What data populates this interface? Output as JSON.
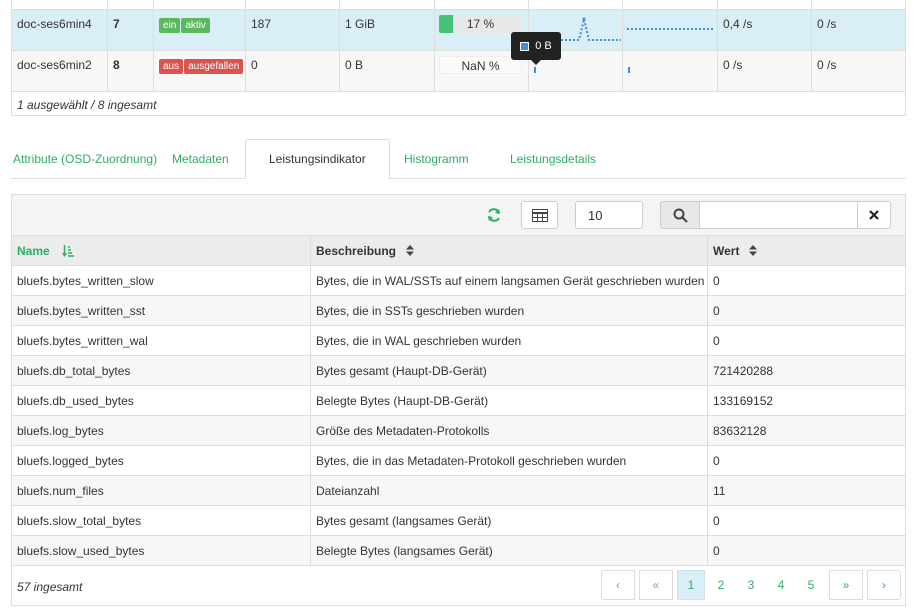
{
  "osd_rows": [
    {
      "host": "doc-ses6min4",
      "id": "7",
      "status": [
        "ein",
        "aktiv"
      ],
      "pgs": "187",
      "size": "1 GiB",
      "usage": "17 %",
      "usage_fraction": 0.17,
      "read_rate": "0,4 /s",
      "write_rate": "0 /s"
    },
    {
      "host": "doc-ses6min2",
      "id": "8",
      "status": [
        "aus",
        "ausgefallen"
      ],
      "pgs": "0",
      "size": "0 B",
      "usage": "NaN %",
      "usage_fraction": 0,
      "read_rate": "0 /s",
      "write_rate": "0 /s"
    }
  ],
  "selection_summary": "1 ausgewählt / 8 ingesamt",
  "tooltip": "0 B",
  "tabs": [
    {
      "label": "Attribute (OSD-Zuordnung)",
      "active": false
    },
    {
      "label": "Metadaten",
      "active": false
    },
    {
      "label": "Leistungsindikator",
      "active": true
    },
    {
      "label": "Histogramm",
      "active": false
    },
    {
      "label": "Leistungsdetails",
      "active": false
    }
  ],
  "toolbar": {
    "page_size": "10",
    "search_placeholder": ""
  },
  "columns": {
    "name": "Name",
    "description": "Beschreibung",
    "value": "Wert"
  },
  "rows": [
    {
      "name": "bluefs.bytes_written_slow",
      "description": "Bytes, die in WAL/SSTs auf einem langsamen Gerät geschrieben wurden",
      "value": "0"
    },
    {
      "name": "bluefs.bytes_written_sst",
      "description": "Bytes, die in SSTs geschrieben wurden",
      "value": "0"
    },
    {
      "name": "bluefs.bytes_written_wal",
      "description": "Bytes, die in WAL geschrieben wurden",
      "value": "0"
    },
    {
      "name": "bluefs.db_total_bytes",
      "description": "Bytes gesamt (Haupt-DB-Gerät)",
      "value": "721420288"
    },
    {
      "name": "bluefs.db_used_bytes",
      "description": "Belegte Bytes (Haupt-DB-Gerät)",
      "value": "133169152"
    },
    {
      "name": "bluefs.log_bytes",
      "description": "Größe des Metadaten-Protokolls",
      "value": "83632128"
    },
    {
      "name": "bluefs.logged_bytes",
      "description": "Bytes, die in das Metadaten-Protokoll geschrieben wurden",
      "value": "0"
    },
    {
      "name": "bluefs.num_files",
      "description": "Dateianzahl",
      "value": "11"
    },
    {
      "name": "bluefs.slow_total_bytes",
      "description": "Bytes gesamt (langsames Gerät)",
      "value": "0"
    },
    {
      "name": "bluefs.slow_used_bytes",
      "description": "Belegte Bytes (langsames Gerät)",
      "value": "0"
    }
  ],
  "footer": {
    "total": "57 ingesamt",
    "pages": [
      "1",
      "2",
      "3",
      "4",
      "5"
    ],
    "prev": "‹",
    "first": "«",
    "last": "»",
    "next": "›"
  },
  "colors": {
    "accent": "#2bae66",
    "selected_row": "#d9eef7",
    "danger": "#d9534f",
    "success": "#5cb85c",
    "spark": "#3d8ee0"
  }
}
